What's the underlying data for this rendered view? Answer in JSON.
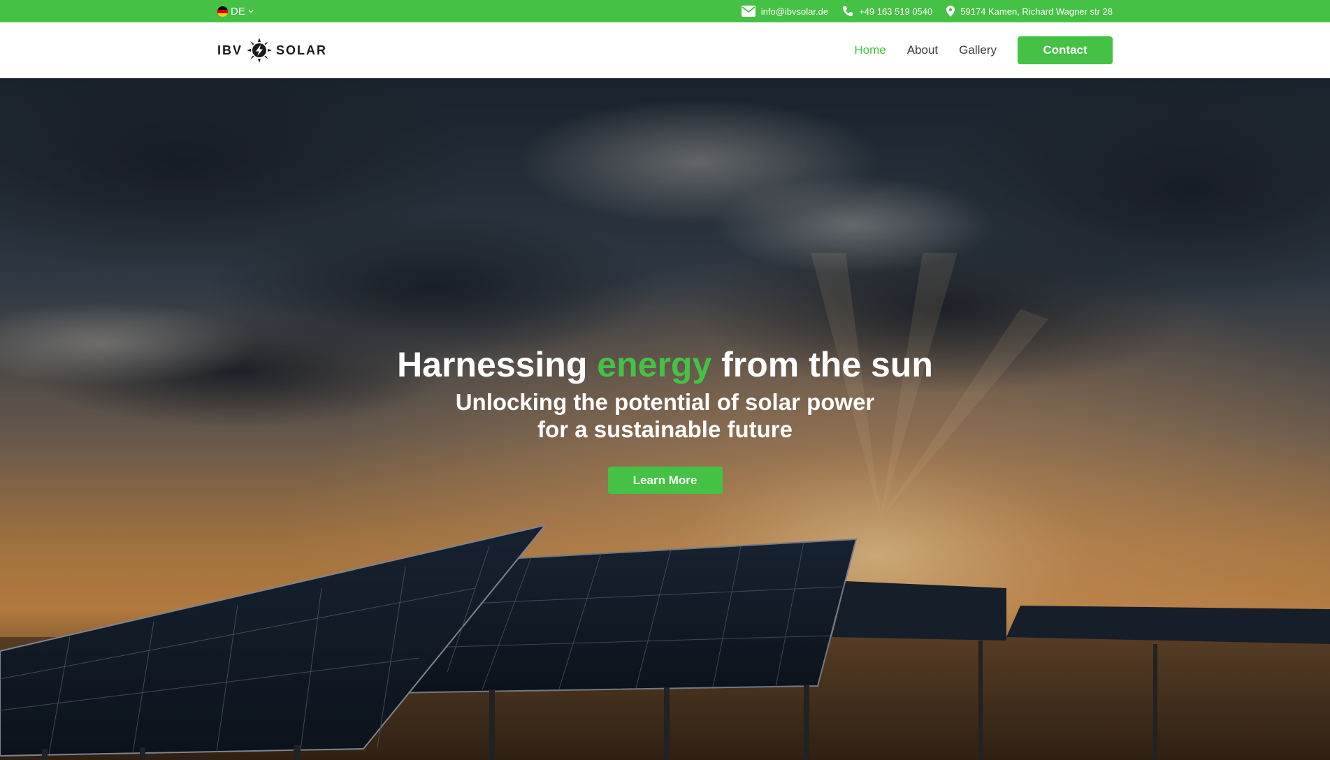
{
  "topbar": {
    "language": "DE",
    "email": "info@ibvsolar.de",
    "phone": "+49 163 519 0540",
    "address": "59174 Kamen, Richard Wagner str 28"
  },
  "brand": {
    "name_left": "IBV",
    "name_right": "SOLAR"
  },
  "nav": {
    "home": "Home",
    "about": "About",
    "gallery": "Gallery",
    "contact": "Contact"
  },
  "hero": {
    "title_before": "Harnessing ",
    "title_accent": "energy",
    "title_after": " from the sun",
    "subtitle_line1": "Unlocking the potential of solar power",
    "subtitle_line2": "for a sustainable future",
    "cta": "Learn More"
  },
  "colors": {
    "accent": "#45c145",
    "text_dark": "#3a3a3a",
    "white": "#ffffff"
  },
  "icons": {
    "email": "envelope-icon",
    "phone": "phone-icon",
    "address": "map-pin-icon",
    "language": "german-flag-icon",
    "dropdown": "chevron-down-icon",
    "logo": "sun-bolt-icon"
  }
}
